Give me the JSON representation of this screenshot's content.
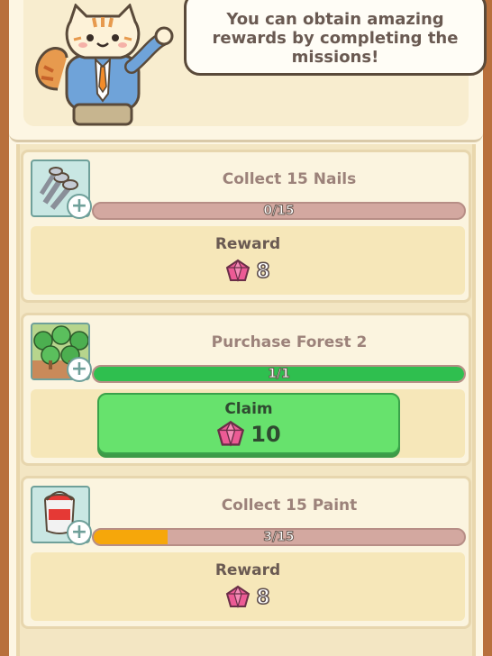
{
  "header": {
    "message": "You can obtain amazing rewards by completing the missions!"
  },
  "missions": [
    {
      "title": "Collect 15 Nails",
      "icon": "nails-icon",
      "progress_text": "0/15",
      "progress": 0.0,
      "bar_color": "#d3a8a0",
      "reward_label": "Reward",
      "reward_value": "8"
    },
    {
      "title": "Purchase Forest 2",
      "icon": "forest-icon",
      "progress_text": "1/1",
      "progress": 1.0,
      "bar_color": "#2fbf4f",
      "claim_label": "Claim",
      "claim_value": "10"
    },
    {
      "title": "Collect 15 Paint",
      "icon": "paint-bucket-icon",
      "progress_text": "3/15",
      "progress": 0.2,
      "bar_color": "#f6a70a",
      "reward_label": "Reward",
      "reward_value": "8"
    }
  ],
  "colors": {
    "gem": "#e94e8e",
    "claim_button": "#67e26d",
    "frame": "#b8703c"
  }
}
